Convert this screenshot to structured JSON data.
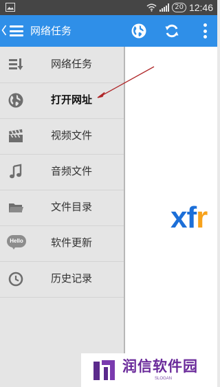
{
  "status_bar": {
    "battery": "20",
    "time": "12:46",
    "icons": [
      "image-icon",
      "wifi-icon",
      "signal-icon"
    ]
  },
  "app_bar": {
    "title": "网络任务",
    "icons": [
      "back-chevron-icon",
      "menu-icon",
      "globe-icon",
      "refresh-icon",
      "more-vertical-icon"
    ]
  },
  "drawer": {
    "items": [
      {
        "label": "网络任务",
        "icon": "list-download-icon"
      },
      {
        "label": "打开网址",
        "icon": "globe-icon",
        "active": true
      },
      {
        "label": "视频文件",
        "icon": "clapperboard-icon"
      },
      {
        "label": "音频文件",
        "icon": "music-note-icon"
      },
      {
        "label": "文件目录",
        "icon": "folder-icon"
      },
      {
        "label": "软件更新",
        "icon": "hello-bubble-icon",
        "icon_text": "Hello"
      },
      {
        "label": "历史记录",
        "icon": "clock-icon"
      }
    ]
  },
  "content": {
    "logo_text_blue": "xf",
    "logo_text_orange": "r"
  },
  "watermark": {
    "text": "润信软件园",
    "slogan": "SLOGAN"
  },
  "colors": {
    "status_bar": "#454545",
    "app_bar": "#2f8fe8",
    "drawer_bg": "#e5e5e5",
    "icon_gray": "#6e6e6e",
    "annotation_arrow": "#b0282a",
    "logo_blue": "#1c6fd8",
    "logo_orange": "#f7a21b",
    "watermark_purple": "#6a2a9a"
  }
}
